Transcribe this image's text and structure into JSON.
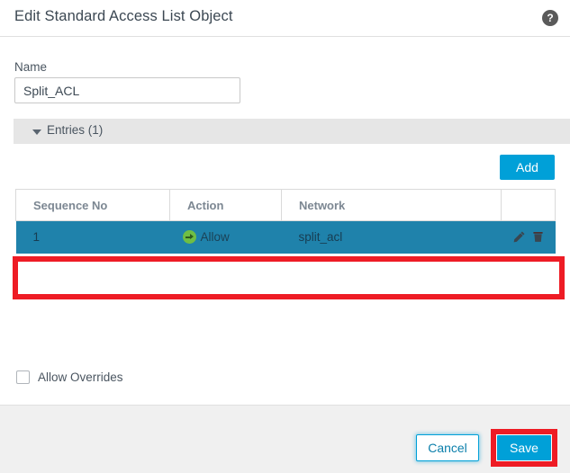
{
  "header": {
    "title": "Edit Standard Access List Object",
    "help_icon": "help-circle-icon",
    "help_glyph": "?"
  },
  "form": {
    "name_label": "Name",
    "name_value": "Split_ACL",
    "name_placeholder": ""
  },
  "entries_section": {
    "caret": "caret-down-icon",
    "label": "Entries (1)",
    "count": 1
  },
  "toolbar": {
    "add_label": "Add"
  },
  "table": {
    "columns": [
      "Sequence No",
      "Action",
      "Network",
      ""
    ],
    "rows": [
      {
        "sequence_no": "1",
        "action": "Allow",
        "action_icon": "allow-arrow-icon",
        "network": "split_acl",
        "edit_icon": "pencil-icon",
        "delete_icon": "trash-icon",
        "selected": true
      }
    ]
  },
  "options": {
    "allow_overrides_label": "Allow Overrides",
    "allow_overrides_checked": false
  },
  "footer": {
    "cancel_label": "Cancel",
    "save_label": "Save"
  },
  "colors": {
    "accent_blue": "#00a0d8",
    "row_selected": "#1f82ab",
    "allow_green": "#6fbe44",
    "annotation_red": "#ee1c25",
    "section_gray": "#e6e6e6",
    "footer_gray": "#f0f0f0"
  }
}
